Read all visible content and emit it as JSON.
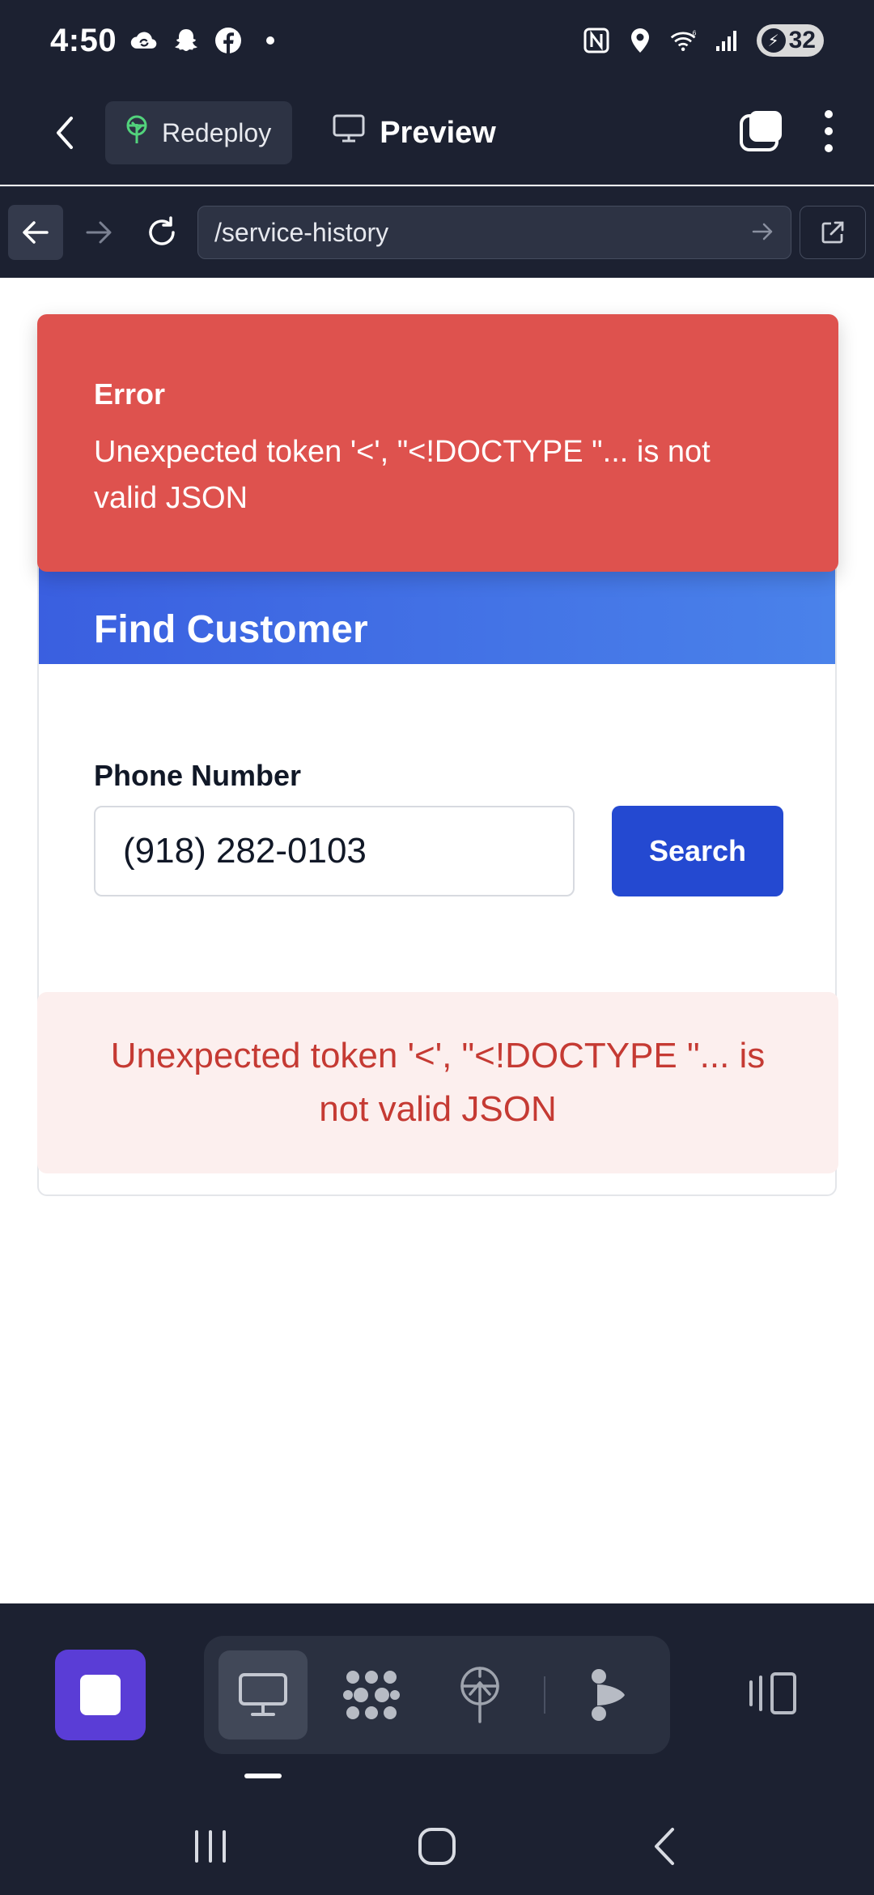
{
  "status_bar": {
    "time": "4:50",
    "battery_level": "32",
    "left_icons": [
      "cloud-sync-icon",
      "snapchat-icon",
      "facebook-icon",
      "dot-icon"
    ],
    "right_icons": [
      "nfc-icon",
      "location-icon",
      "wifi-icon",
      "signal-icon"
    ]
  },
  "header": {
    "redeploy_label": "Redeploy",
    "preview_label": "Preview"
  },
  "url_bar": {
    "path": "/service-history"
  },
  "toast": {
    "title": "Error",
    "message": "Unexpected token '<', \"<!DOCTYPE \"... is not valid JSON"
  },
  "card": {
    "title": "Find Customer",
    "phone_label": "Phone Number",
    "phone_value": "(918) 282-0103",
    "search_label": "Search"
  },
  "error_box": {
    "message": "Unexpected token '<', \"<!DOCTYPE \"... is not valid JSON"
  },
  "colors": {
    "dark_bg": "#1c2131",
    "toast_red": "#de524e",
    "card_gradient_start": "#3a5fe0",
    "card_gradient_end": "#4a82ea",
    "search_button": "#2449d1",
    "error_text": "#c53a33",
    "error_bg": "#fcefee",
    "stop_button": "#5a3dd6"
  },
  "bottom_toolbar": {
    "tools": [
      "desktop-icon",
      "cluster-icon",
      "deploy-tree-icon",
      "agent-icon"
    ]
  }
}
